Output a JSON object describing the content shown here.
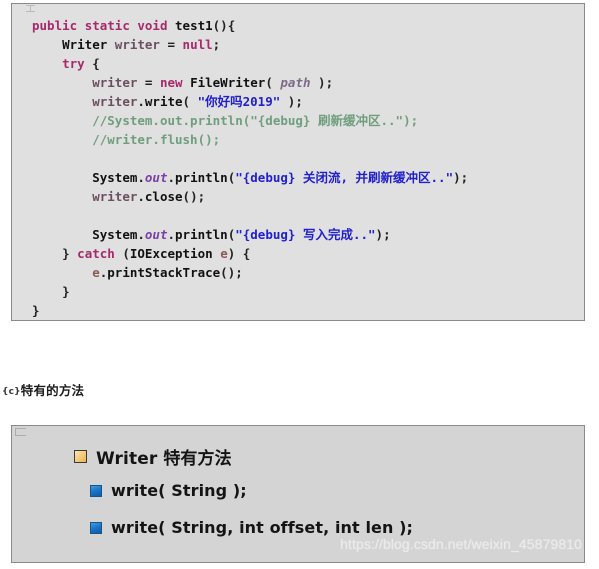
{
  "code_panel": {
    "name": "java-code-snippet",
    "background_color": "#e0e0e0",
    "border_color": "#8a8a8a",
    "colors": {
      "keyword": "#a52a6b",
      "string": "#2020cc",
      "comment": "#6f9e7d",
      "type": "#111111",
      "field": "#7a3fa8",
      "parameter": "#7d6a87",
      "variable": "#8a5a55"
    },
    "lines": [
      {
        "indent": 0,
        "tokens": [
          {
            "t": "public",
            "c": "kw"
          },
          {
            "t": " ",
            "c": "plain"
          },
          {
            "t": "static",
            "c": "kw"
          },
          {
            "t": " ",
            "c": "plain"
          },
          {
            "t": "void",
            "c": "kw"
          },
          {
            "t": " ",
            "c": "plain"
          },
          {
            "t": "test1",
            "c": "type"
          },
          {
            "t": "(){",
            "c": "punc"
          }
        ]
      },
      {
        "indent": 1,
        "tokens": [
          {
            "t": "Writer",
            "c": "type"
          },
          {
            "t": " ",
            "c": "plain"
          },
          {
            "t": "writer",
            "c": "id"
          },
          {
            "t": " ",
            "c": "plain"
          },
          {
            "t": "=",
            "c": "punc"
          },
          {
            "t": " ",
            "c": "plain"
          },
          {
            "t": "null",
            "c": "kw"
          },
          {
            "t": ";",
            "c": "punc"
          }
        ]
      },
      {
        "indent": 1,
        "tokens": [
          {
            "t": "try",
            "c": "kw"
          },
          {
            "t": " ",
            "c": "plain"
          },
          {
            "t": "{",
            "c": "punc"
          }
        ]
      },
      {
        "indent": 2,
        "tokens": [
          {
            "t": "writer",
            "c": "id"
          },
          {
            "t": " ",
            "c": "plain"
          },
          {
            "t": "=",
            "c": "punc"
          },
          {
            "t": " ",
            "c": "plain"
          },
          {
            "t": "new",
            "c": "kw"
          },
          {
            "t": " ",
            "c": "plain"
          },
          {
            "t": "FileWriter",
            "c": "type"
          },
          {
            "t": "( ",
            "c": "punc"
          },
          {
            "t": "path",
            "c": "param"
          },
          {
            "t": " );",
            "c": "punc"
          }
        ]
      },
      {
        "indent": 2,
        "tokens": [
          {
            "t": "writer",
            "c": "id"
          },
          {
            "t": ".",
            "c": "punc"
          },
          {
            "t": "write",
            "c": "type"
          },
          {
            "t": "( ",
            "c": "punc"
          },
          {
            "t": "\"你好吗2019\"",
            "c": "str"
          },
          {
            "t": " );",
            "c": "punc"
          }
        ]
      },
      {
        "indent": 2,
        "tokens": [
          {
            "t": "//System.out.println(\"{debug} 刷新缓冲区..\");",
            "c": "com"
          }
        ]
      },
      {
        "indent": 2,
        "tokens": [
          {
            "t": "//writer.flush();",
            "c": "com"
          }
        ]
      },
      {
        "indent": 0,
        "tokens": []
      },
      {
        "indent": 2,
        "tokens": [
          {
            "t": "System",
            "c": "type"
          },
          {
            "t": ".",
            "c": "punc"
          },
          {
            "t": "out",
            "c": "field"
          },
          {
            "t": ".",
            "c": "punc"
          },
          {
            "t": "println",
            "c": "type"
          },
          {
            "t": "(",
            "c": "punc"
          },
          {
            "t": "\"{debug} 关闭流, 并刷新缓冲区..\"",
            "c": "str"
          },
          {
            "t": ");",
            "c": "punc"
          }
        ]
      },
      {
        "indent": 2,
        "tokens": [
          {
            "t": "writer",
            "c": "id"
          },
          {
            "t": ".",
            "c": "punc"
          },
          {
            "t": "close",
            "c": "type"
          },
          {
            "t": "();",
            "c": "punc"
          }
        ]
      },
      {
        "indent": 0,
        "tokens": []
      },
      {
        "indent": 2,
        "tokens": [
          {
            "t": "System",
            "c": "type"
          },
          {
            "t": ".",
            "c": "punc"
          },
          {
            "t": "out",
            "c": "field"
          },
          {
            "t": ".",
            "c": "punc"
          },
          {
            "t": "println",
            "c": "type"
          },
          {
            "t": "(",
            "c": "punc"
          },
          {
            "t": "\"{debug} 写入完成..\"",
            "c": "str"
          },
          {
            "t": ");",
            "c": "punc"
          }
        ]
      },
      {
        "indent": 1,
        "tokens": [
          {
            "t": "} ",
            "c": "punc"
          },
          {
            "t": "catch",
            "c": "kw"
          },
          {
            "t": " (",
            "c": "punc"
          },
          {
            "t": "IOException",
            "c": "type"
          },
          {
            "t": " ",
            "c": "plain"
          },
          {
            "t": "e",
            "c": "var"
          },
          {
            "t": ") {",
            "c": "punc"
          }
        ]
      },
      {
        "indent": 2,
        "tokens": [
          {
            "t": "e",
            "c": "var"
          },
          {
            "t": ".",
            "c": "punc"
          },
          {
            "t": "printStackTrace",
            "c": "type"
          },
          {
            "t": "();",
            "c": "punc"
          }
        ]
      },
      {
        "indent": 1,
        "tokens": [
          {
            "t": "}",
            "c": "punc"
          }
        ]
      },
      {
        "indent": 0,
        "tokens": [
          {
            "t": "}",
            "c": "punc"
          }
        ]
      }
    ]
  },
  "caption": {
    "prefix": "{c}",
    "text": "特有的方法"
  },
  "slide_panel": {
    "name": "writer-methods-slide",
    "background_color": "#d4d4d4",
    "border_color": "#8a8a8a",
    "rows": [
      {
        "bullet": "orange-square-bullet",
        "level": 0,
        "text": "Writer 特有方法"
      },
      {
        "bullet": "blue-square-bullet",
        "level": 1,
        "text": "write( String );"
      },
      {
        "bullet": "blue-square-bullet",
        "level": 1,
        "text": "write( String, int offset, int len );"
      }
    ],
    "watermark": "https://blog.csdn.net/weixin_45879810"
  }
}
